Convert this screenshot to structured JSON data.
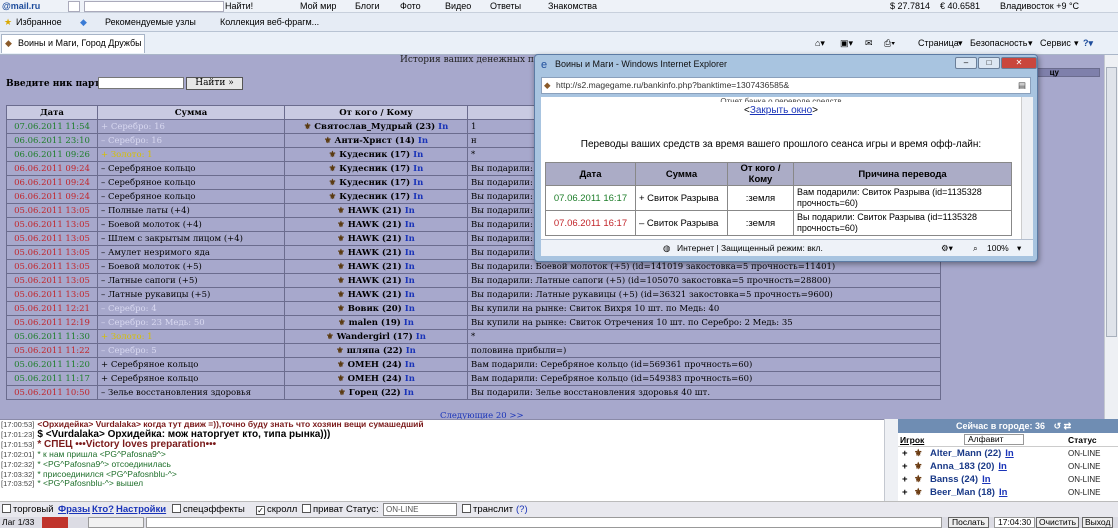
{
  "toolbar1": {
    "logo": "@mail.ru",
    "find_button": "Найти!",
    "my_world": "Мой мир",
    "blogs": "Блоги",
    "photo": "Фото",
    "video": "Видео",
    "answers": "Ответы",
    "dating": "Знакомства",
    "usd": "$ 27.7814",
    "eur": "€ 40.6581",
    "weather": "Владивосток +9 °C"
  },
  "toolbar2": {
    "favorites": "Избранное",
    "recommended": "Рекомендуемые узлы",
    "webslice": "Коллекция веб-фрагм..."
  },
  "tabbar": {
    "tab_title": "Воины и Маги, Город Дружбы",
    "page_menu": "Страница",
    "safety_menu": "Безопасность",
    "service_menu": "Сервис"
  },
  "game": {
    "history_title": "История ваших денежных переводов",
    "partner_label": "Введите ник партнёра:",
    "find_button": "Найти »",
    "right_header": "цу",
    "next_link": "Следующие 20 >>",
    "headers": [
      "Дата",
      "Сумма",
      "От кого / Кому",
      ""
    ],
    "rows": [
      {
        "date": "07.06.2011 11:54",
        "dc": "green",
        "amount": "+ Серебро: 16",
        "ac": "silv",
        "who": "Святослав_Мудрый (23)",
        "ln": "In",
        "reason": "1"
      },
      {
        "date": "06.06.2011 23:10",
        "dc": "green",
        "amount": "– Серебро: 16",
        "ac": "silv",
        "who": "Анти-Христ (14)",
        "ln": "In",
        "reason": "н"
      },
      {
        "date": "06.06.2011 09:26",
        "dc": "green",
        "amount": "+ Золото: 1",
        "ac": "gold",
        "who": "Кудесник (17)",
        "ln": "In",
        "reason": "*"
      },
      {
        "date": "06.06.2011 09:24",
        "dc": "red",
        "amount": "– Серебряное кольцо",
        "ac": "",
        "who": "Кудесник (17)",
        "ln": "In",
        "reason": "Вы подарили: Се"
      },
      {
        "date": "06.06.2011 09:24",
        "dc": "red",
        "amount": "– Серебряное кольцо",
        "ac": "",
        "who": "Кудесник (17)",
        "ln": "In",
        "reason": "Вы подарили: Се"
      },
      {
        "date": "06.06.2011 09:24",
        "dc": "red",
        "amount": "– Серебряное кольцо",
        "ac": "",
        "who": "Кудесник (17)",
        "ln": "In",
        "reason": "Вы подарили: Се"
      },
      {
        "date": "05.06.2011 13:05",
        "dc": "red",
        "amount": "– Полные латы (+4)",
        "ac": "",
        "who": "HAWK (21)",
        "ln": "In",
        "reason": "Вы подарили: П"
      },
      {
        "date": "05.06.2011 13:05",
        "dc": "red",
        "amount": "– Боевой молоток (+4)",
        "ac": "",
        "who": "HAWK (21)",
        "ln": "In",
        "reason": "Вы подарили: Б"
      },
      {
        "date": "05.06.2011 13:05",
        "dc": "red",
        "amount": "– Шлем с закрытым лицом (+4)",
        "ac": "",
        "who": "HAWK (21)",
        "ln": "In",
        "reason": "Вы подарили: Ш"
      },
      {
        "date": "05.06.2011 13:05",
        "dc": "red",
        "amount": "– Амулет незримого яда",
        "ac": "",
        "who": "HAWK (21)",
        "ln": "In",
        "reason": "Вы подарили: А"
      },
      {
        "date": "05.06.2011 13:05",
        "dc": "red",
        "amount": "– Боевой молоток (+5)",
        "ac": "",
        "who": "HAWK (21)",
        "ln": "In",
        "reason": "Вы подарили: Боевой молоток (+5) (id=141019 закостовка=5 прочность=11401)"
      },
      {
        "date": "05.06.2011 13:05",
        "dc": "red",
        "amount": "– Латные сапоги (+5)",
        "ac": "",
        "who": "HAWK (21)",
        "ln": "In",
        "reason": "Вы подарили: Латные сапоги (+5) (id=105070 закостовка=5 прочность=28800)"
      },
      {
        "date": "05.06.2011 13:05",
        "dc": "red",
        "amount": "– Латные рукавицы (+5)",
        "ac": "",
        "who": "HAWK (21)",
        "ln": "In",
        "reason": "Вы подарили: Латные рукавицы (+5) (id=36321 закостовка=5 прочность=9600)"
      },
      {
        "date": "05.06.2011 12:21",
        "dc": "red",
        "amount": "– Серебро: 4",
        "ac": "silv",
        "who": "Вовик (20)",
        "ln": "In",
        "reason": "Вы купили на рынке: Свиток Вихря 10 шт. по Медь: 40"
      },
      {
        "date": "05.06.2011 12:19",
        "dc": "red",
        "amount": "– Серебро: 23 Медь: 50",
        "ac": "silv",
        "who": "malen (19)",
        "ln": "In",
        "reason": "Вы купили на рынке: Свиток Отречения 10 шт. по Серебро: 2 Медь: 35"
      },
      {
        "date": "05.06.2011 11:30",
        "dc": "green",
        "amount": "+ Золото: 1",
        "ac": "gold",
        "who": "Wandergirl (17)",
        "ln": "In",
        "reason": "*"
      },
      {
        "date": "05.06.2011 11:22",
        "dc": "red",
        "amount": "– Серебро: 5",
        "ac": "silv",
        "who": "шляпа (22)",
        "ln": "In",
        "reason": "половина прибыли=)"
      },
      {
        "date": "05.06.2011 11:20",
        "dc": "green",
        "amount": "+ Серебряное кольцо",
        "ac": "",
        "who": "ОМЕН (24)",
        "ln": "In",
        "reason": "Вам подарили: Серебряное кольцо (id=569361 прочность=60)"
      },
      {
        "date": "05.06.2011 11:17",
        "dc": "green",
        "amount": "+ Серебряное кольцо",
        "ac": "",
        "who": "ОМЕН (24)",
        "ln": "In",
        "reason": "Вам подарили: Серебряное кольцо (id=549383 прочность=60)"
      },
      {
        "date": "05.06.2011 10:50",
        "dc": "red",
        "amount": "– Зелье восстановления здоровья",
        "ac": "",
        "who": "Горец (22)",
        "ln": "In",
        "reason": "Вы подарили: Зелье восстановления здоровья 40 шт."
      }
    ]
  },
  "chat": {
    "lines": [
      {
        "time": "[17:00:53]",
        "text": "<Орхидейка> Vurdalaka> когда тут движ =)),точно буду знать что хозяин вещи сумашедший"
      },
      {
        "time": "[17:01:23]",
        "text": "$ <Vurdalaka> Орхидейка: мож наторгует кто, типа рынка)))"
      },
      {
        "time": "[17:01:53]",
        "text": "* СПЕЦ •••Victory loves preparation•••"
      },
      {
        "time": "[17:02:01]",
        "text": "* к нам пришла <PG^Pafosna9^>"
      },
      {
        "time": "[17:02:32]",
        "text": "* <PG^Pafosna9^> отсоединилась"
      },
      {
        "time": "[17:03:32]",
        "text": "* присоединился <PG^Pafosnblu-^>"
      },
      {
        "time": "[17:03:52]",
        "text": "* <PG^Pafosnblu-^> вышел"
      }
    ]
  },
  "people": {
    "header": "Сейчас в городе: 36",
    "col_player": "Игрок",
    "sort_select": "Алфавит",
    "col_status": "Статус",
    "list": [
      {
        "name": "Alter_Mann (22)",
        "ln": "In",
        "status": "ON-LINE"
      },
      {
        "name": "Anna_183 (20)",
        "ln": "In",
        "status": "ON-LINE"
      },
      {
        "name": "Banss (24)",
        "ln": "In",
        "status": "ON-LINE"
      },
      {
        "name": "Beer_Man (18)",
        "ln": "In",
        "status": "ON-LINE"
      }
    ]
  },
  "options": {
    "trade": "торговый",
    "phrases": "Фразы",
    "who": "Кто?",
    "settings": "Настройки",
    "effects": "спецэффекты",
    "scroll": "скролл",
    "private": "приват",
    "status_label": "Статус:",
    "status_value": "ON-LINE",
    "translit": "транслит",
    "help": "(?)"
  },
  "inputbar": {
    "lag": "Лаг 1/33",
    "send": "Послать",
    "time": "17:04:30",
    "clear": "Очистить",
    "exit": "Выход"
  },
  "popup": {
    "window_title": "Воины и Маги - Windows Internet Explorer",
    "url": "http://s2.magegame.ru/bankinfo.php?banktime=1307436585&",
    "cut_title": "Отчет банка о переводе средств",
    "close_link": "Закрыть окно",
    "description": "Переводы ваших средств за время вашего прошлого сеанса игры и время офф-лайн:",
    "headers": [
      "Дата",
      "Сумма",
      "От кого / Кому",
      "Причина перевода"
    ],
    "rows": [
      {
        "date": "07.06.2011 16:17",
        "dc": "green",
        "amount": "+ Свиток Разрыва",
        "who": ":земля",
        "reason": "Вам подарили: Свиток Разрыва (id=1135328 прочность=60)"
      },
      {
        "date": "07.06.2011 16:17",
        "dc": "red",
        "amount": "– Свиток Разрыва",
        "who": ":земля",
        "reason": "Вы подарили: Свиток Разрыва (id=1135328 прочность=60)"
      }
    ],
    "status_zone": "Интернет | Защищенный режим: вкл.",
    "zoom": "100%"
  }
}
